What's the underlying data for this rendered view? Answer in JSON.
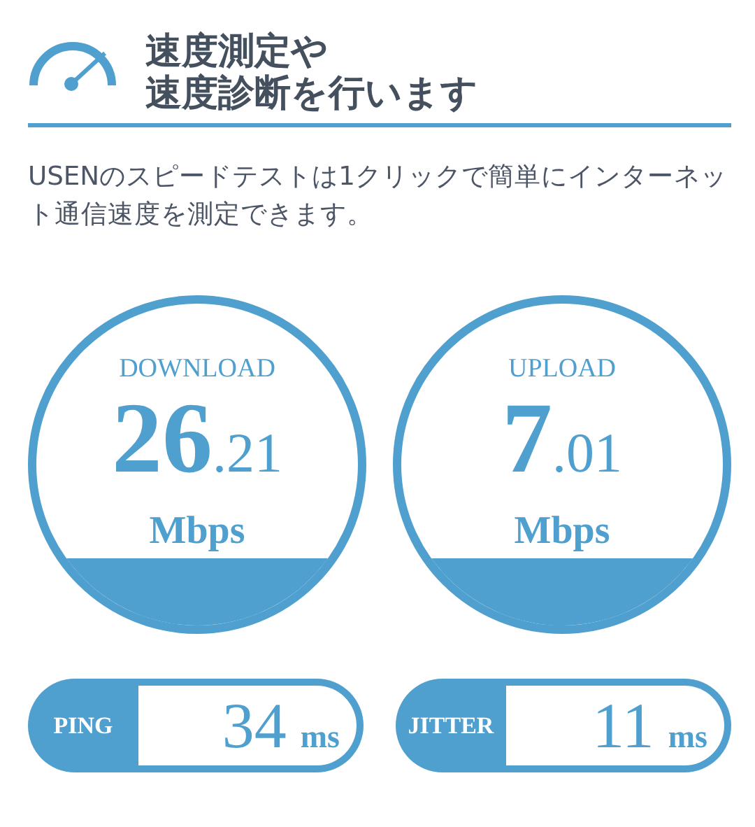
{
  "header": {
    "title_lines": [
      "速度測定や",
      "速度診断を行います"
    ]
  },
  "description": "USENのスピードテストは1クリックで簡単にインターネット通信速度を測定できます。",
  "meters": [
    {
      "label": "DOWNLOAD",
      "integer": "26",
      "decimal": ".21",
      "unit": "Mbps"
    },
    {
      "label": "UPLOAD",
      "integer": "7",
      "decimal": ".01",
      "unit": "Mbps"
    }
  ],
  "stats": [
    {
      "label": "PING",
      "value": "34",
      "unit": "ms"
    },
    {
      "label": "JITTER",
      "value": "11",
      "unit": "ms"
    }
  ]
}
